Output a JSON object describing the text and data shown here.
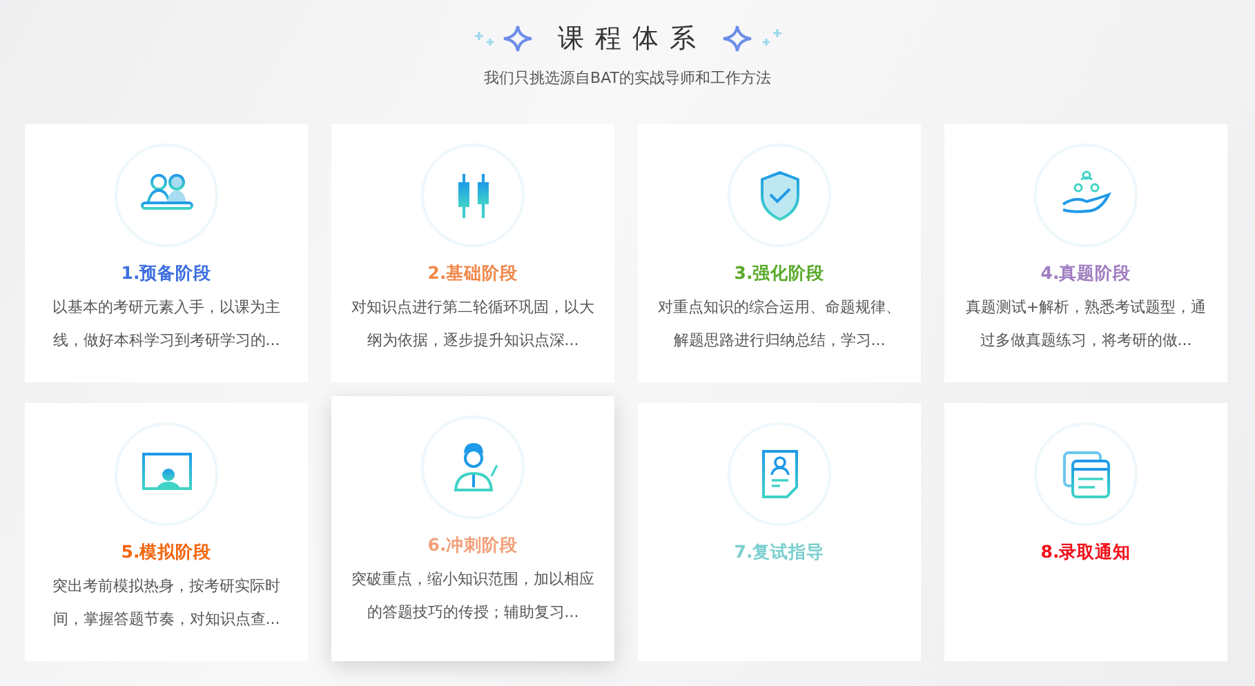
{
  "header": {
    "title": "课 程 体 系",
    "subtitle": "我们只挑选源自BAT的实战导师和工作方法"
  },
  "stages": [
    {
      "kind": "people",
      "title": "1.预备阶段",
      "color": "#3d6fe0",
      "raised": false,
      "description": "以基本的考研元素入手，以课为主线，做好本科学习到考研学习的..."
    },
    {
      "kind": "candles",
      "title": "2.基础阶段",
      "color": "#f0884a",
      "raised": false,
      "description": "对知识点进行第二轮循环巩固，以大纲为依据，逐步提升知识点深..."
    },
    {
      "kind": "shield",
      "title": "3.强化阶段",
      "color": "#5aaa2c",
      "raised": false,
      "description": "对重点知识的综合运用、命题规律、解题思路进行归纳总结，学习..."
    },
    {
      "kind": "hand",
      "title": "4.真题阶段",
      "color": "#a07ec0",
      "raised": false,
      "description": "真题测试+解析，熟悉考试题型，通过多做真题练习，将考研的做..."
    },
    {
      "kind": "screen",
      "title": "5.模拟阶段",
      "color": "#f2660f",
      "raised": false,
      "description": "突出考前模拟热身，按考研实际时间，掌握答题节奏，对知识点查..."
    },
    {
      "kind": "person",
      "title": "6.冲刺阶段",
      "color": "#f3a07a",
      "raised": true,
      "description": "突破重点，缩小知识范围，加以相应的答题技巧的传授；辅助复习..."
    },
    {
      "kind": "document",
      "title": "7.复试指导",
      "color": "#7ccfcf",
      "raised": false
    },
    {
      "kind": "cards",
      "title": "8.录取通知",
      "color": "#f0101a",
      "raised": false
    }
  ]
}
